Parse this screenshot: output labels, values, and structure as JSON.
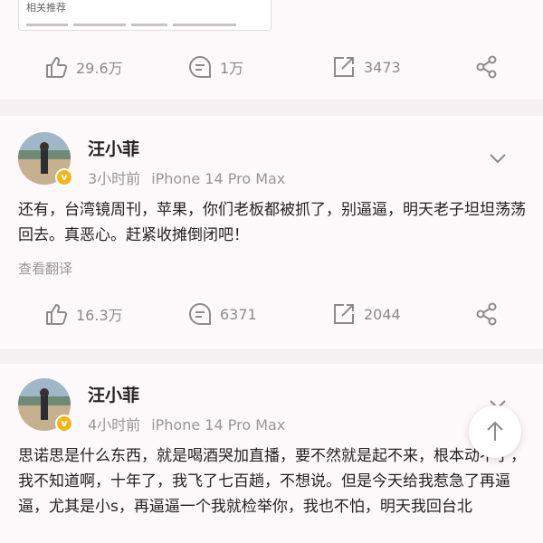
{
  "top_card": {
    "related_label": "相关推荐",
    "actions": {
      "likes": "29.6万",
      "comments": "1万",
      "reposts": "3473"
    }
  },
  "posts": [
    {
      "author": "汪小菲",
      "time": "3小时前",
      "device": "iPhone 14 Pro Max",
      "text": "还有，台湾镜周刊，苹果，你们老板都被抓了，别逼逼，明天老子坦坦荡荡回去。真恶心。赶紧收摊倒闭吧！",
      "translate": "查看翻译",
      "actions": {
        "likes": "16.3万",
        "comments": "6371",
        "reposts": "2044"
      }
    },
    {
      "author": "汪小菲",
      "time": "4小时前",
      "device": "iPhone 14 Pro Max",
      "text": "思诺思是什么东西，就是喝酒哭加直播，要不然就是起不来，根本动不了，我不知道啊，十年了，我飞了七百趟，不想说。但是今天给我惹急了再逼逼，尤其是小s，再逼逼一个我就检举你，我也不怕，明天我回台北"
    }
  ],
  "colors": {
    "verified_badge": "#f3b51b",
    "page_bg": "#f7f0f2",
    "card_bg": "#fdf8f9",
    "icon_gray": "#8e8a8c"
  }
}
